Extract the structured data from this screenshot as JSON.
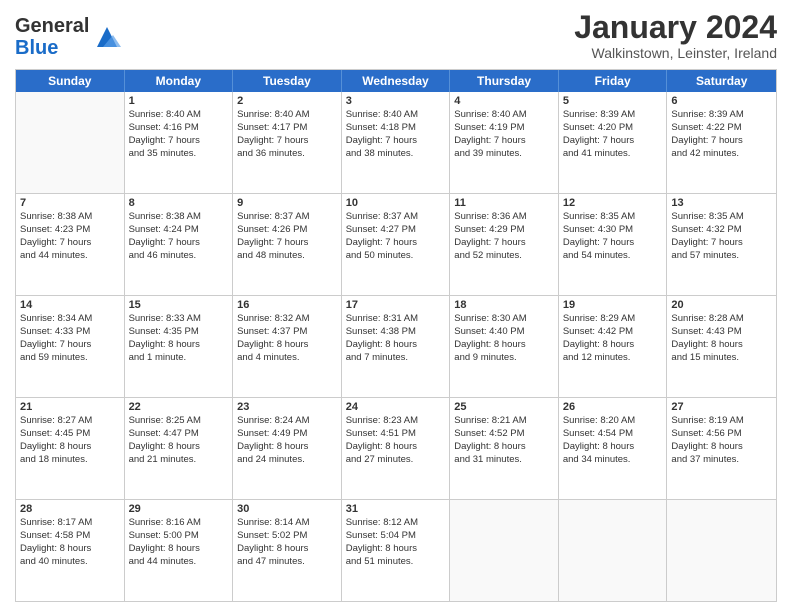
{
  "header": {
    "logo": {
      "general": "General",
      "blue": "Blue"
    },
    "title": "January 2024",
    "location": "Walkinstown, Leinster, Ireland"
  },
  "days": [
    "Sunday",
    "Monday",
    "Tuesday",
    "Wednesday",
    "Thursday",
    "Friday",
    "Saturday"
  ],
  "rows": [
    [
      {
        "day": "",
        "empty": true
      },
      {
        "day": "1",
        "sunrise": "Sunrise: 8:40 AM",
        "sunset": "Sunset: 4:16 PM",
        "daylight": "Daylight: 7 hours",
        "daylight2": "and 35 minutes."
      },
      {
        "day": "2",
        "sunrise": "Sunrise: 8:40 AM",
        "sunset": "Sunset: 4:17 PM",
        "daylight": "Daylight: 7 hours",
        "daylight2": "and 36 minutes."
      },
      {
        "day": "3",
        "sunrise": "Sunrise: 8:40 AM",
        "sunset": "Sunset: 4:18 PM",
        "daylight": "Daylight: 7 hours",
        "daylight2": "and 38 minutes."
      },
      {
        "day": "4",
        "sunrise": "Sunrise: 8:40 AM",
        "sunset": "Sunset: 4:19 PM",
        "daylight": "Daylight: 7 hours",
        "daylight2": "and 39 minutes."
      },
      {
        "day": "5",
        "sunrise": "Sunrise: 8:39 AM",
        "sunset": "Sunset: 4:20 PM",
        "daylight": "Daylight: 7 hours",
        "daylight2": "and 41 minutes."
      },
      {
        "day": "6",
        "sunrise": "Sunrise: 8:39 AM",
        "sunset": "Sunset: 4:22 PM",
        "daylight": "Daylight: 7 hours",
        "daylight2": "and 42 minutes."
      }
    ],
    [
      {
        "day": "7",
        "sunrise": "Sunrise: 8:38 AM",
        "sunset": "Sunset: 4:23 PM",
        "daylight": "Daylight: 7 hours",
        "daylight2": "and 44 minutes."
      },
      {
        "day": "8",
        "sunrise": "Sunrise: 8:38 AM",
        "sunset": "Sunset: 4:24 PM",
        "daylight": "Daylight: 7 hours",
        "daylight2": "and 46 minutes."
      },
      {
        "day": "9",
        "sunrise": "Sunrise: 8:37 AM",
        "sunset": "Sunset: 4:26 PM",
        "daylight": "Daylight: 7 hours",
        "daylight2": "and 48 minutes."
      },
      {
        "day": "10",
        "sunrise": "Sunrise: 8:37 AM",
        "sunset": "Sunset: 4:27 PM",
        "daylight": "Daylight: 7 hours",
        "daylight2": "and 50 minutes."
      },
      {
        "day": "11",
        "sunrise": "Sunrise: 8:36 AM",
        "sunset": "Sunset: 4:29 PM",
        "daylight": "Daylight: 7 hours",
        "daylight2": "and 52 minutes."
      },
      {
        "day": "12",
        "sunrise": "Sunrise: 8:35 AM",
        "sunset": "Sunset: 4:30 PM",
        "daylight": "Daylight: 7 hours",
        "daylight2": "and 54 minutes."
      },
      {
        "day": "13",
        "sunrise": "Sunrise: 8:35 AM",
        "sunset": "Sunset: 4:32 PM",
        "daylight": "Daylight: 7 hours",
        "daylight2": "and 57 minutes."
      }
    ],
    [
      {
        "day": "14",
        "sunrise": "Sunrise: 8:34 AM",
        "sunset": "Sunset: 4:33 PM",
        "daylight": "Daylight: 7 hours",
        "daylight2": "and 59 minutes."
      },
      {
        "day": "15",
        "sunrise": "Sunrise: 8:33 AM",
        "sunset": "Sunset: 4:35 PM",
        "daylight": "Daylight: 8 hours",
        "daylight2": "and 1 minute."
      },
      {
        "day": "16",
        "sunrise": "Sunrise: 8:32 AM",
        "sunset": "Sunset: 4:37 PM",
        "daylight": "Daylight: 8 hours",
        "daylight2": "and 4 minutes."
      },
      {
        "day": "17",
        "sunrise": "Sunrise: 8:31 AM",
        "sunset": "Sunset: 4:38 PM",
        "daylight": "Daylight: 8 hours",
        "daylight2": "and 7 minutes."
      },
      {
        "day": "18",
        "sunrise": "Sunrise: 8:30 AM",
        "sunset": "Sunset: 4:40 PM",
        "daylight": "Daylight: 8 hours",
        "daylight2": "and 9 minutes."
      },
      {
        "day": "19",
        "sunrise": "Sunrise: 8:29 AM",
        "sunset": "Sunset: 4:42 PM",
        "daylight": "Daylight: 8 hours",
        "daylight2": "and 12 minutes."
      },
      {
        "day": "20",
        "sunrise": "Sunrise: 8:28 AM",
        "sunset": "Sunset: 4:43 PM",
        "daylight": "Daylight: 8 hours",
        "daylight2": "and 15 minutes."
      }
    ],
    [
      {
        "day": "21",
        "sunrise": "Sunrise: 8:27 AM",
        "sunset": "Sunset: 4:45 PM",
        "daylight": "Daylight: 8 hours",
        "daylight2": "and 18 minutes."
      },
      {
        "day": "22",
        "sunrise": "Sunrise: 8:25 AM",
        "sunset": "Sunset: 4:47 PM",
        "daylight": "Daylight: 8 hours",
        "daylight2": "and 21 minutes."
      },
      {
        "day": "23",
        "sunrise": "Sunrise: 8:24 AM",
        "sunset": "Sunset: 4:49 PM",
        "daylight": "Daylight: 8 hours",
        "daylight2": "and 24 minutes."
      },
      {
        "day": "24",
        "sunrise": "Sunrise: 8:23 AM",
        "sunset": "Sunset: 4:51 PM",
        "daylight": "Daylight: 8 hours",
        "daylight2": "and 27 minutes."
      },
      {
        "day": "25",
        "sunrise": "Sunrise: 8:21 AM",
        "sunset": "Sunset: 4:52 PM",
        "daylight": "Daylight: 8 hours",
        "daylight2": "and 31 minutes."
      },
      {
        "day": "26",
        "sunrise": "Sunrise: 8:20 AM",
        "sunset": "Sunset: 4:54 PM",
        "daylight": "Daylight: 8 hours",
        "daylight2": "and 34 minutes."
      },
      {
        "day": "27",
        "sunrise": "Sunrise: 8:19 AM",
        "sunset": "Sunset: 4:56 PM",
        "daylight": "Daylight: 8 hours",
        "daylight2": "and 37 minutes."
      }
    ],
    [
      {
        "day": "28",
        "sunrise": "Sunrise: 8:17 AM",
        "sunset": "Sunset: 4:58 PM",
        "daylight": "Daylight: 8 hours",
        "daylight2": "and 40 minutes."
      },
      {
        "day": "29",
        "sunrise": "Sunrise: 8:16 AM",
        "sunset": "Sunset: 5:00 PM",
        "daylight": "Daylight: 8 hours",
        "daylight2": "and 44 minutes."
      },
      {
        "day": "30",
        "sunrise": "Sunrise: 8:14 AM",
        "sunset": "Sunset: 5:02 PM",
        "daylight": "Daylight: 8 hours",
        "daylight2": "and 47 minutes."
      },
      {
        "day": "31",
        "sunrise": "Sunrise: 8:12 AM",
        "sunset": "Sunset: 5:04 PM",
        "daylight": "Daylight: 8 hours",
        "daylight2": "and 51 minutes."
      },
      {
        "day": "",
        "empty": true
      },
      {
        "day": "",
        "empty": true
      },
      {
        "day": "",
        "empty": true
      }
    ]
  ]
}
